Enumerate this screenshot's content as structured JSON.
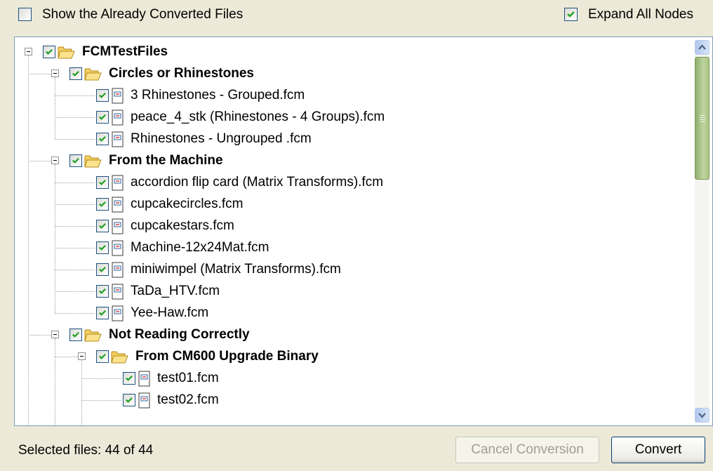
{
  "options": {
    "show_converted_label": "Show the Already Converted Files",
    "show_converted_checked": false,
    "expand_all_label": "Expand All Nodes",
    "expand_all_checked": true
  },
  "tree": [
    {
      "label": "FCMTestFiles",
      "type": "folder",
      "level": 0,
      "checked": true,
      "expanded": true
    },
    {
      "label": "Circles or Rhinestones",
      "type": "folder",
      "level": 1,
      "checked": true,
      "expanded": true
    },
    {
      "label": "3 Rhinestones - Grouped.fcm",
      "type": "file",
      "level": 2,
      "checked": true
    },
    {
      "label": "peace_4_stk (Rhinestones - 4 Groups).fcm",
      "type": "file",
      "level": 2,
      "checked": true
    },
    {
      "label": "Rhinestones - Ungrouped .fcm",
      "type": "file",
      "level": 2,
      "checked": true
    },
    {
      "label": "From the Machine",
      "type": "folder",
      "level": 1,
      "checked": true,
      "expanded": true
    },
    {
      "label": "accordion flip card (Matrix Transforms).fcm",
      "type": "file",
      "level": 2,
      "checked": true
    },
    {
      "label": "cupcakecircles.fcm",
      "type": "file",
      "level": 2,
      "checked": true
    },
    {
      "label": "cupcakestars.fcm",
      "type": "file",
      "level": 2,
      "checked": true
    },
    {
      "label": "Machine-12x24Mat.fcm",
      "type": "file",
      "level": 2,
      "checked": true
    },
    {
      "label": "miniwimpel (Matrix Transforms).fcm",
      "type": "file",
      "level": 2,
      "checked": true
    },
    {
      "label": "TaDa_HTV.fcm",
      "type": "file",
      "level": 2,
      "checked": true
    },
    {
      "label": "Yee-Haw.fcm",
      "type": "file",
      "level": 2,
      "checked": true
    },
    {
      "label": "Not Reading Correctly",
      "type": "folder",
      "level": 1,
      "checked": true,
      "expanded": true
    },
    {
      "label": "From CM600 Upgrade Binary",
      "type": "folder",
      "level": 2,
      "checked": true,
      "expanded": true
    },
    {
      "label": "test01.fcm",
      "type": "file",
      "level": 3,
      "checked": true
    },
    {
      "label": "test02.fcm",
      "type": "file",
      "level": 3,
      "checked": true
    }
  ],
  "status_text": "Selected files: 44 of 44",
  "buttons": {
    "cancel_label": "Cancel Conversion",
    "cancel_enabled": false,
    "convert_label": "Convert"
  },
  "colors": {
    "window_bg": "#ece9d8",
    "check": "#21a121",
    "scroll_thumb": "#a8c484",
    "disabled_text": "#a19f95"
  },
  "icons": {
    "folder": "open-folder-icon",
    "file": "fcm-file-icon",
    "check": "checkmark-icon",
    "collapse": "minus-expander-icon"
  }
}
